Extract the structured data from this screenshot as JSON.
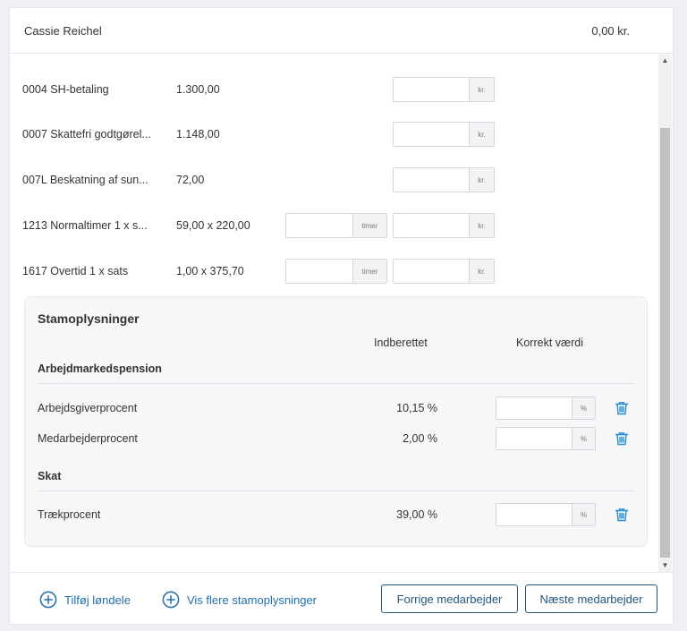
{
  "header": {
    "name": "Cassie Reichel",
    "total": "0,00 kr."
  },
  "rows": [
    {
      "label": "0004 SH-betaling",
      "value": "1.300,00",
      "has_timer": false
    },
    {
      "label": "0007 Skattefri godtgørel...",
      "value": "1.148,00",
      "has_timer": false
    },
    {
      "label": "007L Beskatning af sun...",
      "value": "72,00",
      "has_timer": false
    },
    {
      "label": "1213 Normaltimer 1 x s...",
      "value": "59,00 x 220,00",
      "has_timer": true
    },
    {
      "label": "1617 Overtid 1 x sats",
      "value": "1,00 x 375,70",
      "has_timer": true
    }
  ],
  "units": {
    "kr": "kr.",
    "timer": "timer",
    "pct": "%"
  },
  "stam": {
    "title": "Stamoplysninger",
    "col_reported": "Indberettet",
    "col_correct": "Korrekt værdi",
    "sections": [
      {
        "title": "Arbejdmarkedspension",
        "rows": [
          {
            "label": "Arbejdsgiverprocent",
            "value": "10,15 %"
          },
          {
            "label": "Medarbejderprocent",
            "value": "2,00 %"
          }
        ]
      },
      {
        "title": "Skat",
        "rows": [
          {
            "label": "Trækprocent",
            "value": "39,00 %"
          }
        ]
      }
    ]
  },
  "footer": {
    "add_label": "Tilføj løndele",
    "more_label": "Vis flere stamoplysninger",
    "prev_label": "Forrige medarbejder",
    "next_label": "Næste medarbejder"
  },
  "colors": {
    "accent": "#1f6fae",
    "button": "#24577f",
    "icon": "#2a8ec9"
  },
  "icons": {
    "add": "plus-circle-icon",
    "delete": "trash-icon"
  }
}
